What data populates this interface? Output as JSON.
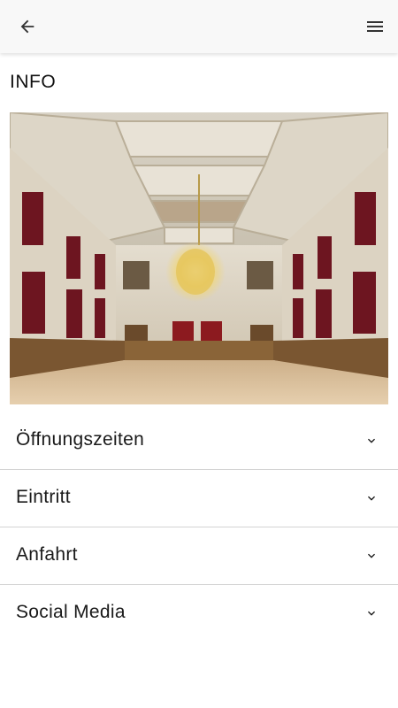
{
  "header": {
    "back_icon": "arrow-left-icon",
    "menu_icon": "hamburger-menu-icon"
  },
  "page": {
    "title": "INFO"
  },
  "hero_image": {
    "description_icon": "hall-photo"
  },
  "accordion": {
    "items": [
      {
        "label": "Öffnungszeiten",
        "icon": "chevron-down-icon"
      },
      {
        "label": "Eintritt",
        "icon": "chevron-down-icon"
      },
      {
        "label": "Anfahrt",
        "icon": "chevron-down-icon"
      },
      {
        "label": "Social Media",
        "icon": "chevron-down-icon"
      }
    ]
  },
  "colors": {
    "app_bar": "#f8f8f8",
    "divider": "#d4d4d4",
    "text": "#1a1a1a"
  }
}
